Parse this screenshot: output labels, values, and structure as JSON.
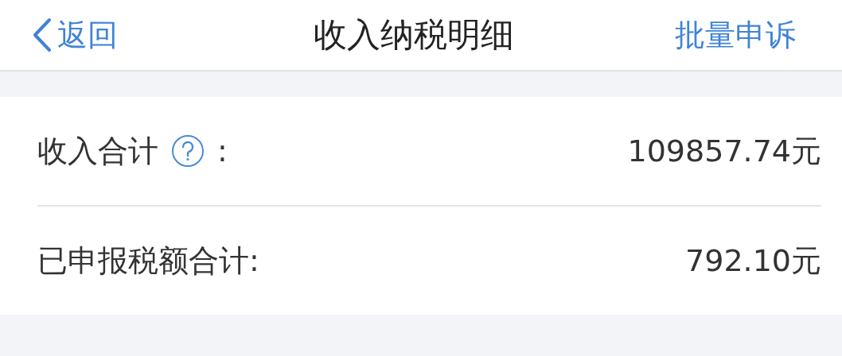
{
  "nav": {
    "back": "返回",
    "title": "收入纳税明细",
    "action": "批量申诉"
  },
  "summary": [
    {
      "kind": "help",
      "label": "收入合计",
      "colon": ":",
      "value": "109857.74元"
    },
    {
      "kind": "plain",
      "label": "已申报税额合计:",
      "value": "792.10元"
    }
  ]
}
